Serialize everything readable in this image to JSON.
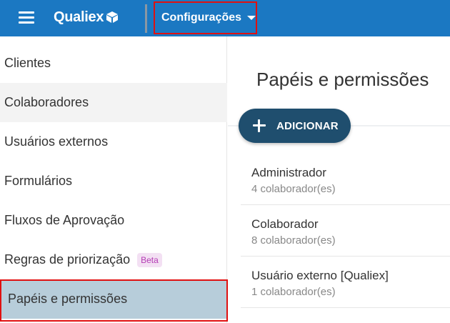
{
  "header": {
    "logo_text": "Qualiex",
    "menu_label": "Configurações",
    "colors": {
      "bar": "#1b78c2",
      "highlight": "#e01010"
    }
  },
  "sidebar": {
    "items": [
      {
        "label": "Clientes"
      },
      {
        "label": "Colaboradores"
      },
      {
        "label": "Usuários externos"
      },
      {
        "label": "Formulários"
      },
      {
        "label": "Fluxos de Aprovação"
      },
      {
        "label": "Regras de priorização",
        "badge": "Beta"
      },
      {
        "label": "Papéis e permissões"
      }
    ]
  },
  "main": {
    "title": "Papéis e permissões",
    "add_label": "ADICIONAR",
    "roles": [
      {
        "name": "Administrador",
        "count": "4 colaborador(es)"
      },
      {
        "name": "Colaborador",
        "count": "8 colaborador(es)"
      },
      {
        "name": "Usuário externo [Qualiex]",
        "count": "1 colaborador(es)"
      }
    ]
  }
}
